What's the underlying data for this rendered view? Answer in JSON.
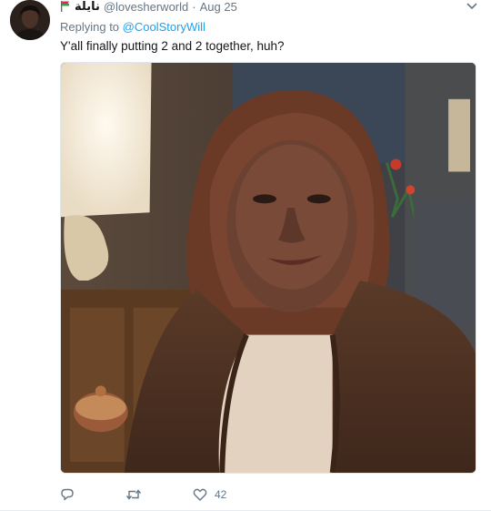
{
  "tweet": {
    "display_name": "نايلة",
    "handle": "@lovesherworld",
    "separator": "·",
    "timestamp": "Aug 25",
    "reply_prefix": "Replying to",
    "reply_mention": "@CoolStoryWill",
    "text": "Y'all finally putting 2 and 2 together, huh?",
    "like_count": "42"
  },
  "icons": {
    "flag": "flag-icon",
    "menu": "chevron-down-icon",
    "reply": "reply-icon",
    "retweet": "retweet-icon",
    "like": "heart-icon"
  },
  "colors": {
    "link": "#1da1f2",
    "secondary_text": "#657786",
    "primary_text": "#14171a"
  }
}
